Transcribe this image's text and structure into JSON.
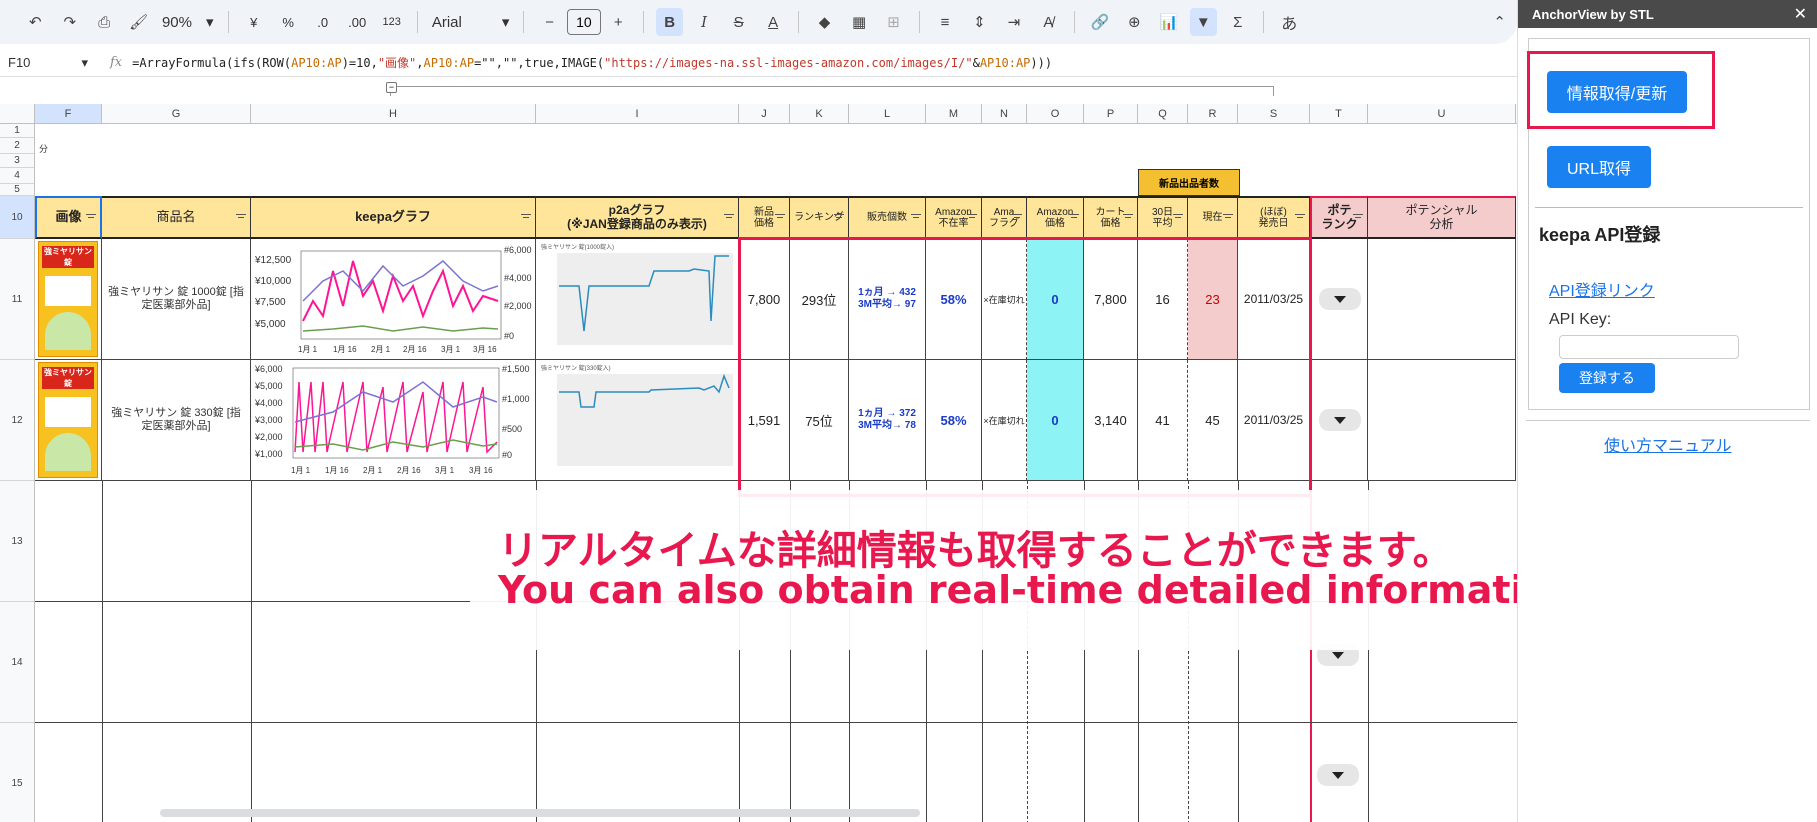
{
  "toolbar": {
    "zoom": "90%",
    "currency": "¥",
    "percent": "%",
    "dec_dec": ".0",
    "dec_inc": ".00",
    "number_format": "123",
    "font": "Arial",
    "font_size": "10",
    "input_tools": "あ"
  },
  "formula_bar": {
    "cell_ref": "F10",
    "formula_prefix": "=ArrayFormula(ifs(ROW(",
    "ref1": "AP10:AP",
    "part2": ")=10,",
    "str1": "\"画像\"",
    "part3": ",",
    "ref2": "AP10:AP",
    "part4": "=\"\",\"\",true,IMAGE(",
    "str2": "\"https://images-na.ssl-images-amazon.com/images/I/\"",
    "part5": "&",
    "ref3": "AP10:AP",
    "part6": ")))"
  },
  "columns": [
    "F",
    "G",
    "H",
    "I",
    "J",
    "K",
    "L",
    "M",
    "N",
    "O",
    "P",
    "Q",
    "R",
    "S",
    "T",
    "U"
  ],
  "rows": [
    "1",
    "2",
    "3",
    "4",
    "5",
    "10",
    "11",
    "12",
    "13",
    "14",
    "15"
  ],
  "row2_text": "分",
  "group_header": "新品出品者数",
  "headers": {
    "image": "画像",
    "name": "商品名",
    "keepa": "keepaグラフ",
    "p2a_line1": "p2aグラフ",
    "p2a_line2": "(※JAN登録商品のみ表示)",
    "new_price_1": "新品",
    "new_price_2": "価格",
    "ranking": "ランキング",
    "sales": "販売個数",
    "amz_out_1": "Amazon",
    "amz_out_2": "不在率",
    "ama_flag_1": "Ama",
    "ama_flag_2": "フラグ",
    "amz_price_1": "Amazon",
    "amz_price_2": "価格",
    "cart_1": "カート",
    "cart_2": "価格",
    "avg30_1": "30日",
    "avg30_2": "平均",
    "current": "現在",
    "release_1": "(ほぼ)",
    "release_2": "発売日",
    "pote_1": "ポテ",
    "pote_2": "ランク",
    "potential_1": "ポテンシャル",
    "potential_2": "分析"
  },
  "products": [
    {
      "name": "強ミヤリサン 錠 1000錠 [指定医薬部外品]",
      "keepa_y": [
        "¥12,500",
        "¥10,000",
        "¥7,500",
        "¥5,000"
      ],
      "keepa_r": [
        "#6,000",
        "#4,000",
        "#2,000",
        "#0"
      ],
      "keepa_x": [
        "1月 1",
        "1月 16",
        "2月 1",
        "2月 16",
        "3月 1",
        "3月 16"
      ],
      "p2a_title": "強ミヤリサン 錠(1000錠入)",
      "new_price": "7,800",
      "ranking": "293位",
      "sales_1": "1ヵ月 → 432",
      "sales_2": "3M平均→ 97",
      "amz_out": "58%",
      "ama_flag": "×在庫切れ",
      "amz_price": "0",
      "cart_price": "7,800",
      "avg30": "16",
      "current": "23",
      "release": "2011/03/25"
    },
    {
      "name": "強ミヤリサン 錠 330錠 [指定医薬部外品]",
      "keepa_y": [
        "¥6,000",
        "¥5,000",
        "¥4,000",
        "¥3,000",
        "¥2,000",
        "¥1,000"
      ],
      "keepa_r": [
        "#1,500",
        "#1,000",
        "#500",
        "#0"
      ],
      "keepa_x": [
        "1月 1",
        "1月 16",
        "2月 1",
        "2月 16",
        "3月 1",
        "3月 16"
      ],
      "p2a_title": "強ミヤリサン 錠(330錠入)",
      "new_price": "1,591",
      "ranking": "75位",
      "sales_1": "1ヵ月 → 372",
      "sales_2": "3M平均→ 78",
      "amz_out": "58%",
      "ama_flag": "×在庫切れ",
      "amz_price": "0",
      "cart_price": "3,140",
      "avg30": "41",
      "current": "45",
      "release": "2011/03/25"
    }
  ],
  "product_label": "強ミヤリサン錠",
  "overlay": {
    "jp": "リアルタイムな詳細情報も取得することができます。",
    "en": "You can also obtain real-time detailed information."
  },
  "panel": {
    "title": "AnchorView by STL",
    "close": "✕",
    "btn_fetch": "情報取得/更新",
    "btn_url": "URL取得",
    "api_title": "keepa API登録",
    "api_link": "API登録リンク",
    "api_key_label": "API Key:",
    "api_key_value": "",
    "register": "登録する",
    "manual": "使い方マニュアル"
  },
  "colors": {
    "accent_red": "#e8174d",
    "header_yellow": "#ffe599",
    "button_blue": "#1a82f0",
    "cyan": "#8ef3f5",
    "pink": "#f4cccc"
  }
}
